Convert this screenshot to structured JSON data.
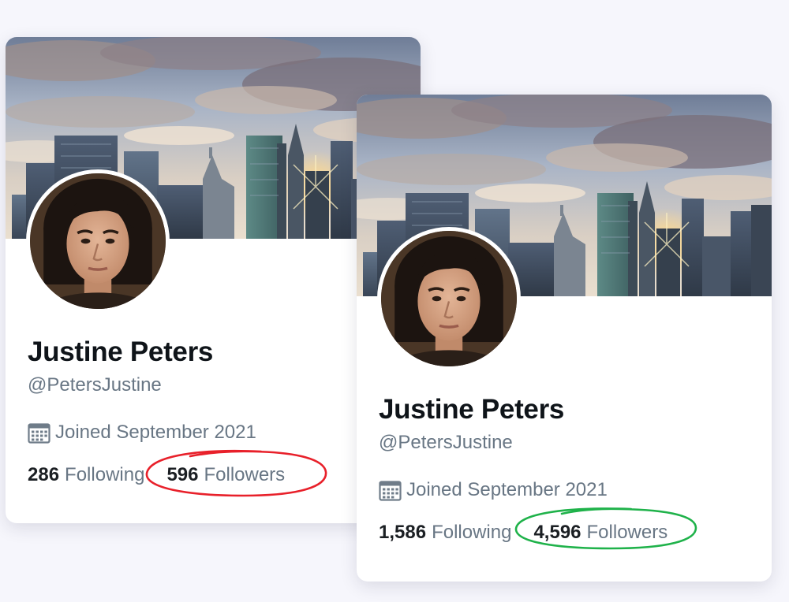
{
  "cards": [
    {
      "name": "Justine Peters",
      "handle": "@PetersJustine",
      "joined": "Joined September 2021",
      "following_count": "286",
      "following_label": "Following",
      "followers_count": "596",
      "followers_label": "Followers",
      "highlight_color": "#e8202a"
    },
    {
      "name": "Justine Peters",
      "handle": "@PetersJustine",
      "joined": "Joined September 2021",
      "following_count": "1,586",
      "following_label": "Following",
      "followers_count": "4,596",
      "followers_label": "Followers",
      "highlight_color": "#1fb24a"
    }
  ],
  "icons": {
    "calendar": "calendar-icon",
    "avatar": "profile-photo",
    "banner": "city-skyline-header"
  }
}
